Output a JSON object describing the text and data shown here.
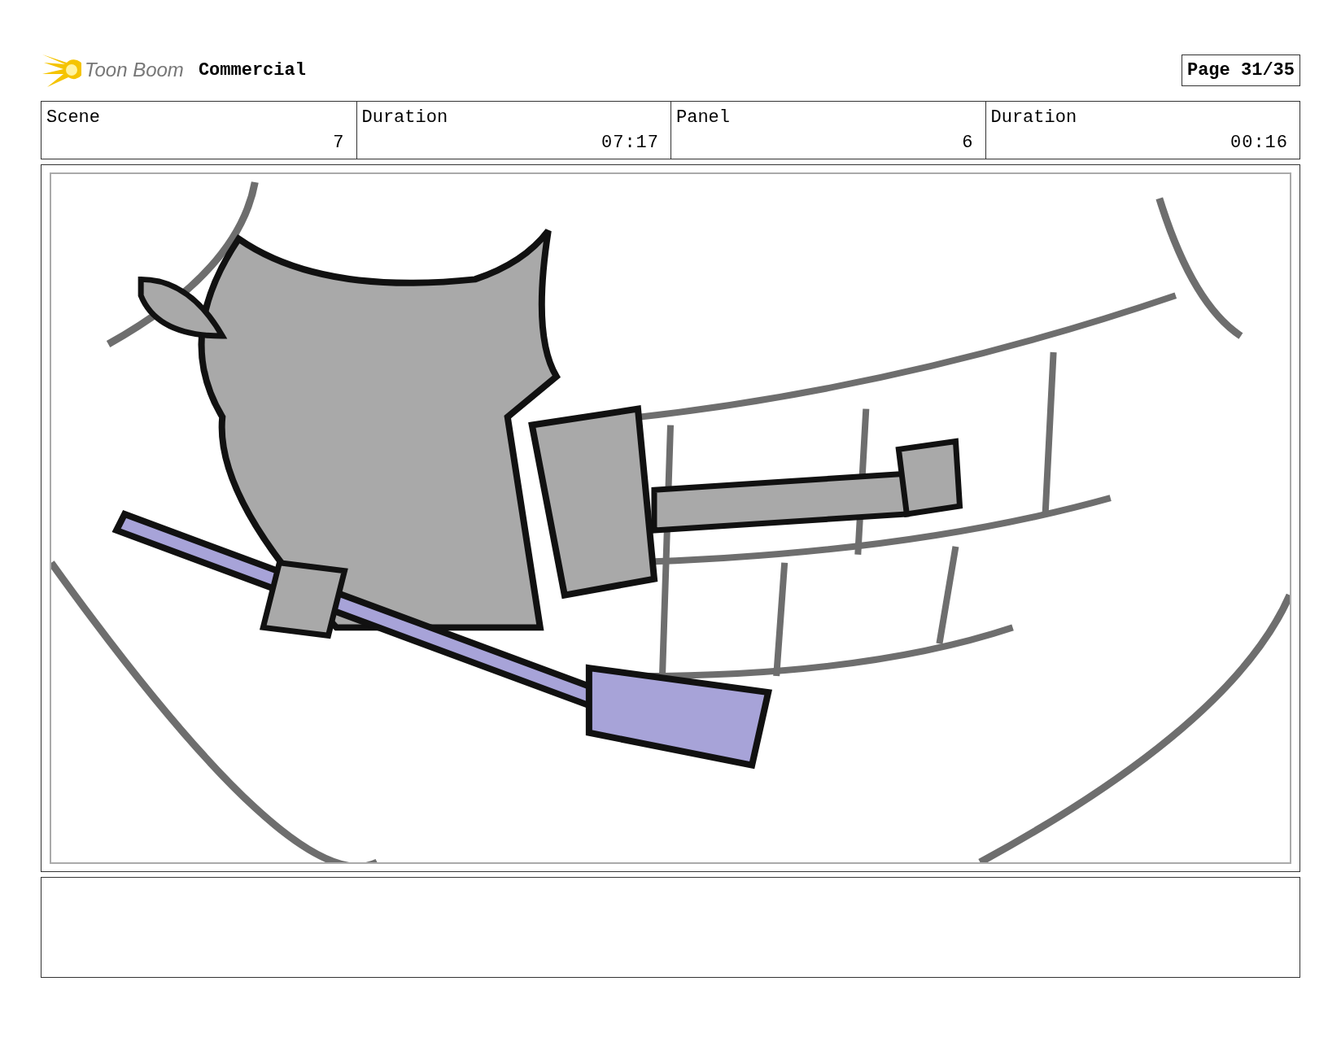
{
  "header": {
    "logo": "Toon Boom",
    "title": "Commercial",
    "page": "Page 31/35"
  },
  "fields": [
    {
      "label": "Scene",
      "value": "7"
    },
    {
      "label": "Duration",
      "value": "07:17"
    },
    {
      "label": "Panel",
      "value": "6"
    },
    {
      "label": "Duration",
      "value": "00:16"
    }
  ]
}
